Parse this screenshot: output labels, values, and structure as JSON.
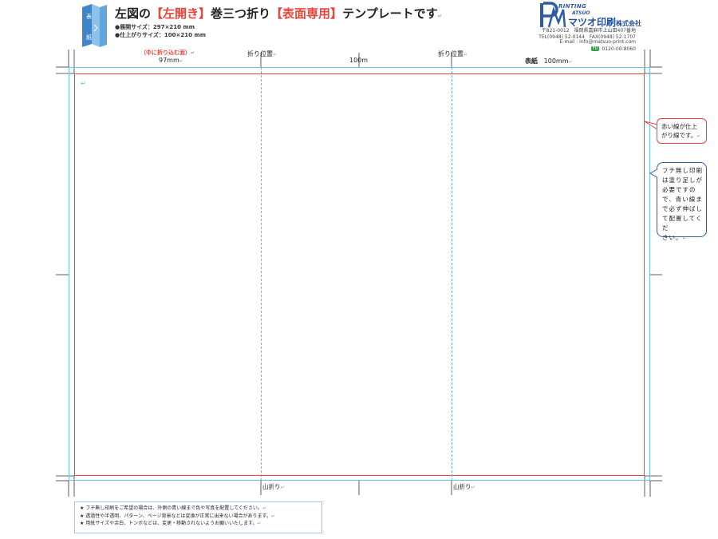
{
  "header": {
    "title_prefix": "左図の",
    "title_red1": "【左開き】",
    "title_mid": "巻三つ折り",
    "title_red2": "【表面専用】",
    "title_suffix": "テンプレートです",
    "spec_open": "●展開サイズ：297×210 mm",
    "spec_finish": "●仕上がりサイズ：100×210 mm",
    "thumbnail_labels": [
      "表",
      "紙"
    ]
  },
  "company": {
    "logo_text": "PRINTING MATSUO",
    "logo_printing": "RINTING",
    "logo_matsuo": "ATSUO",
    "name": "マツオ印刷",
    "name_suffix": "株式会社",
    "address": "〒821-0012　福岡県嘉麻市上山田407番地",
    "tel_fax": "TEL(0948) 52-0144　FAX(0948) 52-1707",
    "email": "E-mail : info@matsuo-print.com",
    "free_badge": "FD",
    "freedial": "0120-00-8060"
  },
  "top_labels": {
    "inner_fold_panel": "（中に折り込む面）",
    "panel1_width": "97mm",
    "fold_position_1": "折り位置",
    "panel2_width": "100m",
    "fold_position_2": "折り位置",
    "cover": "表紙",
    "cover_width": "100mm"
  },
  "bubbles": {
    "red_note": [
      "赤い線が仕上",
      "がり線です。"
    ],
    "blue_note": [
      "フチ無し印刷",
      "は塗り足しが",
      "必要ですの",
      "で、青い線ま",
      "で必ず伸ばし",
      "て配置してくだ",
      "さい。"
    ]
  },
  "bottom_labels": {
    "mountain_fold_1": "山折り",
    "mountain_fold_2": "山折り"
  },
  "notes": [
    "★ フチ無し印刷をご希望の場合は、外側の青い線まで色や写真を配置してください。",
    "★ 透過性や半透明、パターン、ページ背景などは変換が正常に出来ない場合があります。",
    "★ 用紙サイズや余白、トンボなどは、変更・移動されないようお願いいたします。"
  ],
  "colors": {
    "trim_line": "#e8453c",
    "bleed_line": "#6ec6ea",
    "fold_line": "#5fb8e3",
    "accent_red": "#e8453c",
    "brand_blue": "#2a5da6"
  }
}
